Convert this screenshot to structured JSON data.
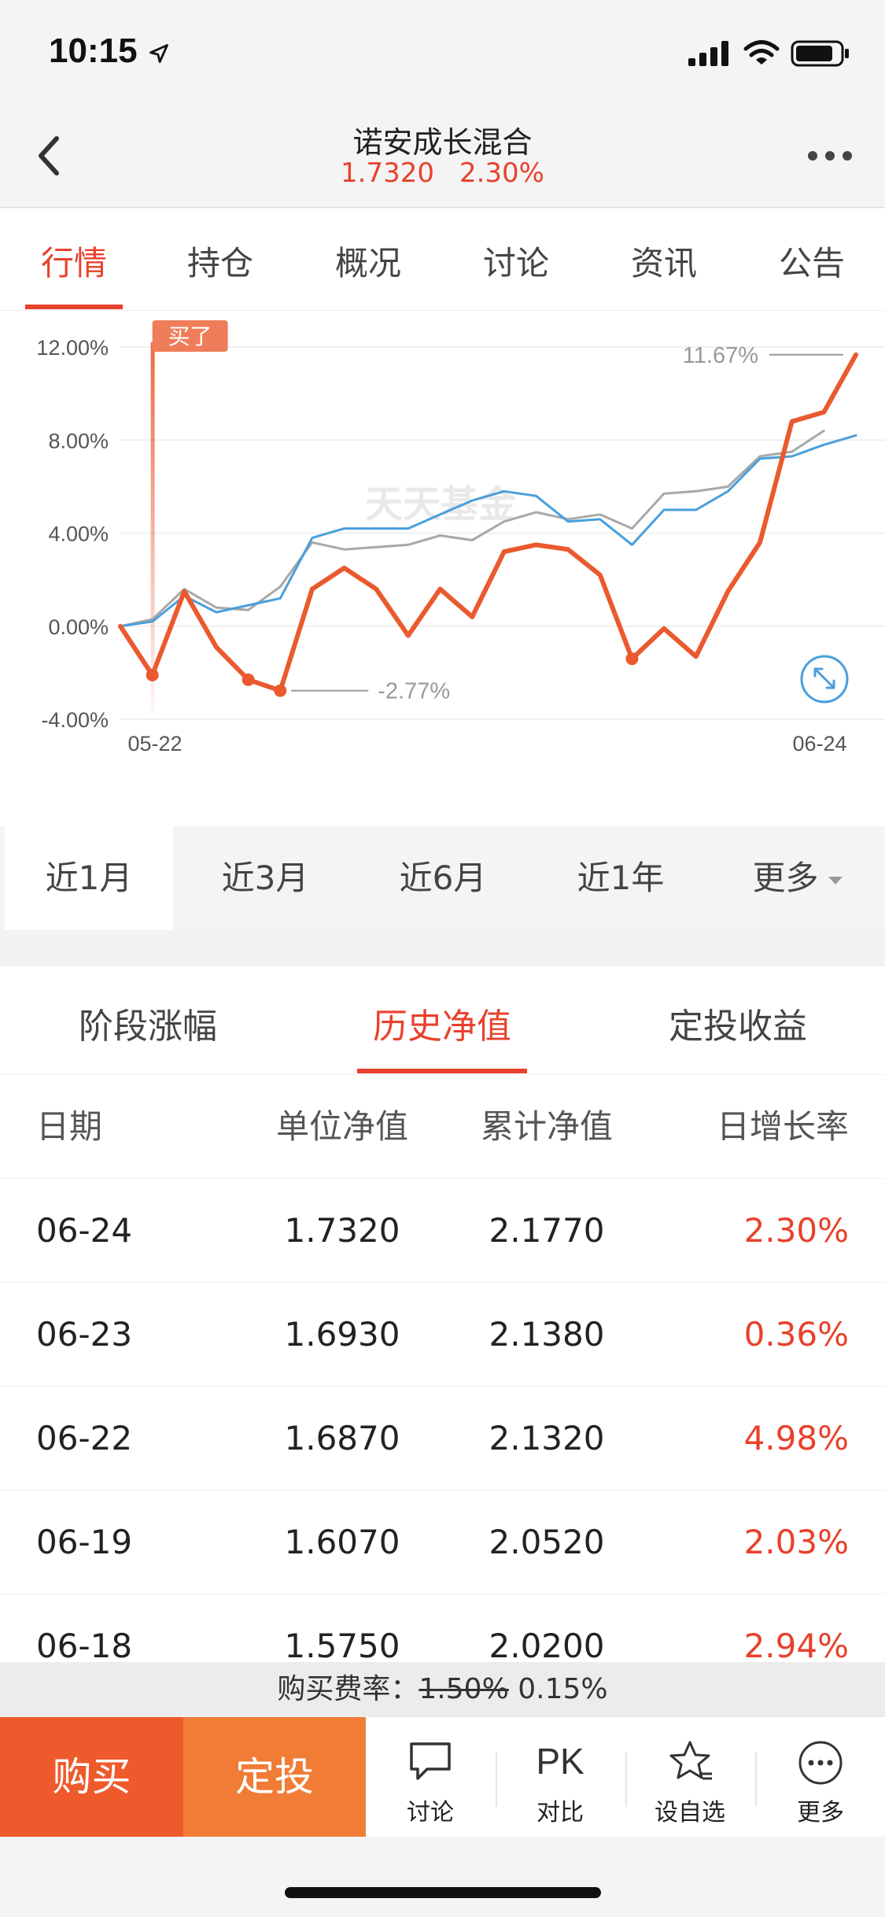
{
  "status_bar": {
    "time": "10:15"
  },
  "header": {
    "title": "诺安成长混合",
    "nav_value": "1.7320",
    "change_pct": "2.30%"
  },
  "tabs": [
    {
      "label": "行情",
      "active": true
    },
    {
      "label": "持仓"
    },
    {
      "label": "概况"
    },
    {
      "label": "讨论"
    },
    {
      "label": "资讯"
    },
    {
      "label": "公告"
    }
  ],
  "chart_data": {
    "type": "line",
    "watermark": "天天基金",
    "y_ticks": [
      "12.00%",
      "8.00%",
      "4.00%",
      "0.00%",
      "-4.00%"
    ],
    "ylim": [
      -4,
      12
    ],
    "x_start_label": "05-22",
    "x_end_label": "06-24",
    "max_label": "11.67%",
    "min_label": "-2.77%",
    "buy_marker": "买了",
    "series": [
      {
        "color": "#ea5a2e",
        "values": [
          0.0,
          -2.1,
          1.5,
          -0.9,
          -2.3,
          -2.77,
          1.6,
          2.5,
          1.6,
          -0.4,
          1.6,
          0.4,
          3.2,
          3.5,
          3.3,
          2.2,
          -1.4,
          -0.1,
          -1.3,
          1.5,
          3.6,
          8.8,
          9.2,
          11.67
        ]
      },
      {
        "color": "#4a9fdc",
        "values": [
          0.0,
          0.2,
          1.3,
          0.6,
          0.9,
          1.2,
          3.8,
          4.2,
          4.2,
          4.2,
          4.8,
          5.4,
          5.8,
          5.6,
          4.5,
          4.6,
          3.5,
          5.0,
          5.0,
          5.8,
          7.2,
          7.3,
          7.8,
          8.2
        ]
      },
      {
        "color": "#a8a8a8",
        "values": [
          0.0,
          0.3,
          1.6,
          0.8,
          0.7,
          1.7,
          3.6,
          3.3,
          3.4,
          3.5,
          3.9,
          3.7,
          4.5,
          4.9,
          4.6,
          4.8,
          4.2,
          5.7,
          5.8,
          6.0,
          7.3,
          7.5,
          8.4
        ]
      }
    ],
    "highlight_points": [
      {
        "series": 0,
        "index": 1
      },
      {
        "series": 0,
        "index": 4
      },
      {
        "series": 0,
        "index": 5
      },
      {
        "series": 0,
        "index": 16
      }
    ],
    "buy_index": 1
  },
  "periods": [
    {
      "label": "近1月",
      "active": true
    },
    {
      "label": "近3月"
    },
    {
      "label": "近6月"
    },
    {
      "label": "近1年"
    },
    {
      "label": "更多"
    }
  ],
  "section_tabs": [
    {
      "label": "阶段涨幅"
    },
    {
      "label": "历史净值",
      "active": true
    },
    {
      "label": "定投收益"
    }
  ],
  "table": {
    "headers": [
      "日期",
      "单位净值",
      "累计净值",
      "日增长率"
    ],
    "rows": [
      [
        "06-24",
        "1.7320",
        "2.1770",
        "2.30%"
      ],
      [
        "06-23",
        "1.6930",
        "2.1380",
        "0.36%"
      ],
      [
        "06-22",
        "1.6870",
        "2.1320",
        "4.98%"
      ],
      [
        "06-19",
        "1.6070",
        "2.0520",
        "2.03%"
      ],
      [
        "06-18",
        "1.5750",
        "2.0200",
        "2.94%"
      ]
    ]
  },
  "fee": {
    "label": "购买费率：",
    "original": "1.50%",
    "current": "0.15%"
  },
  "bottom_bar": {
    "buy": "购买",
    "auto_invest": "定投",
    "discuss": "讨论",
    "compare_icon_text": "PK",
    "compare": "对比",
    "watchlist": "设自选",
    "more": "更多"
  },
  "colors": {
    "accent": "#e8412c",
    "buy": "#ee5a2c",
    "auto_invest": "#f07c36",
    "series_blue": "#4a9fdc",
    "series_gray": "#a8a8a8"
  }
}
